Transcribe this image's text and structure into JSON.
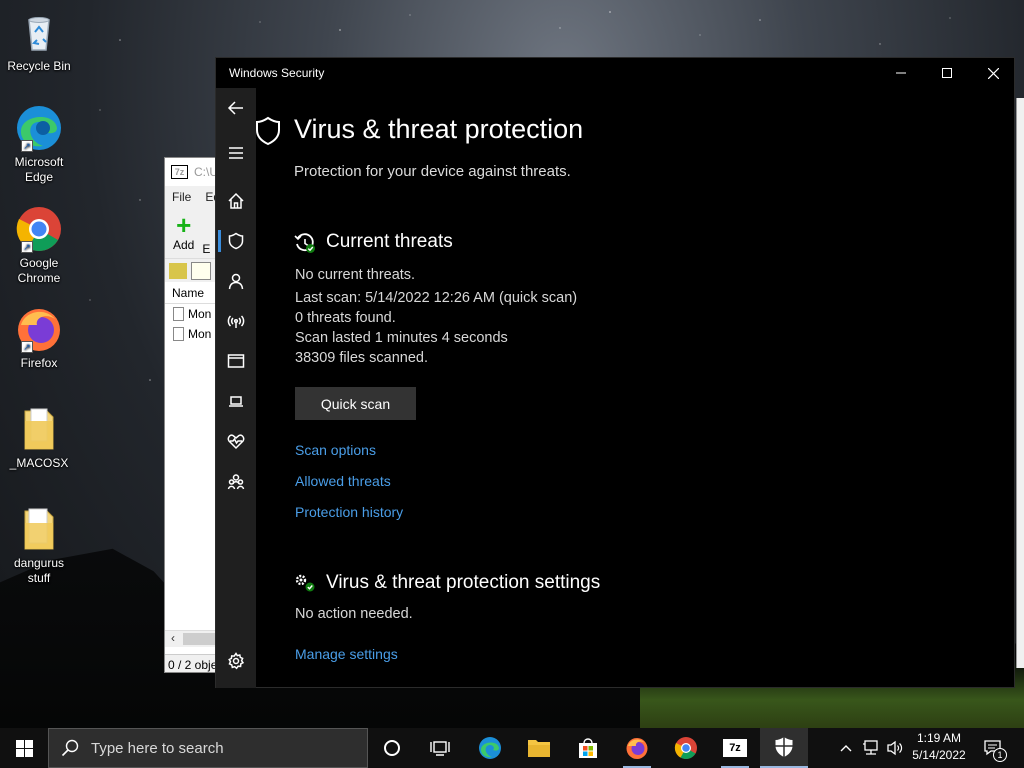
{
  "desktop": {
    "icons": [
      {
        "label": "Recycle Bin"
      },
      {
        "label": "Microsoft Edge"
      },
      {
        "label": "Google Chrome"
      },
      {
        "label": "Firefox"
      },
      {
        "label": "_MACOSX"
      },
      {
        "label": "dangurus stuff"
      }
    ]
  },
  "zip": {
    "title_fragment": "C:\\U",
    "logo": "7z",
    "menu": [
      "File",
      "Ed"
    ],
    "add_label": "Add",
    "second_tool_fragment": "E",
    "column_name": "Name",
    "files": [
      "Mon",
      "Mon"
    ],
    "status_fragment": "0 / 2 obje"
  },
  "window": {
    "title": "Windows Security",
    "minimize_glyph": "—",
    "maximize_glyph": "☐",
    "close_glyph": "✕"
  },
  "page": {
    "title": "Virus & threat protection",
    "subtitle": "Protection for your device against threats."
  },
  "current_threats": {
    "heading": "Current threats",
    "status": "No current threats.",
    "last_scan": "Last scan: 5/14/2022 12:26 AM (quick scan)",
    "threats_found": "0 threats found.",
    "scan_duration": "Scan lasted 1 minutes 4 seconds",
    "files_scanned": "38309 files scanned.",
    "quick_scan_label": "Quick scan",
    "links": [
      "Scan options",
      "Allowed threats",
      "Protection history"
    ]
  },
  "settings": {
    "heading": "Virus & threat protection settings",
    "status": "No action needed.",
    "manage_link": "Manage settings"
  },
  "taskbar": {
    "search_placeholder": "Type here to search",
    "time": "1:19 AM",
    "date": "5/14/2022",
    "notification_count": "1",
    "zip_label": "7z"
  },
  "colors": {
    "accent_link": "#4a9ee8",
    "nav_indicator": "#3a8ddd",
    "button_bg": "#333333"
  }
}
